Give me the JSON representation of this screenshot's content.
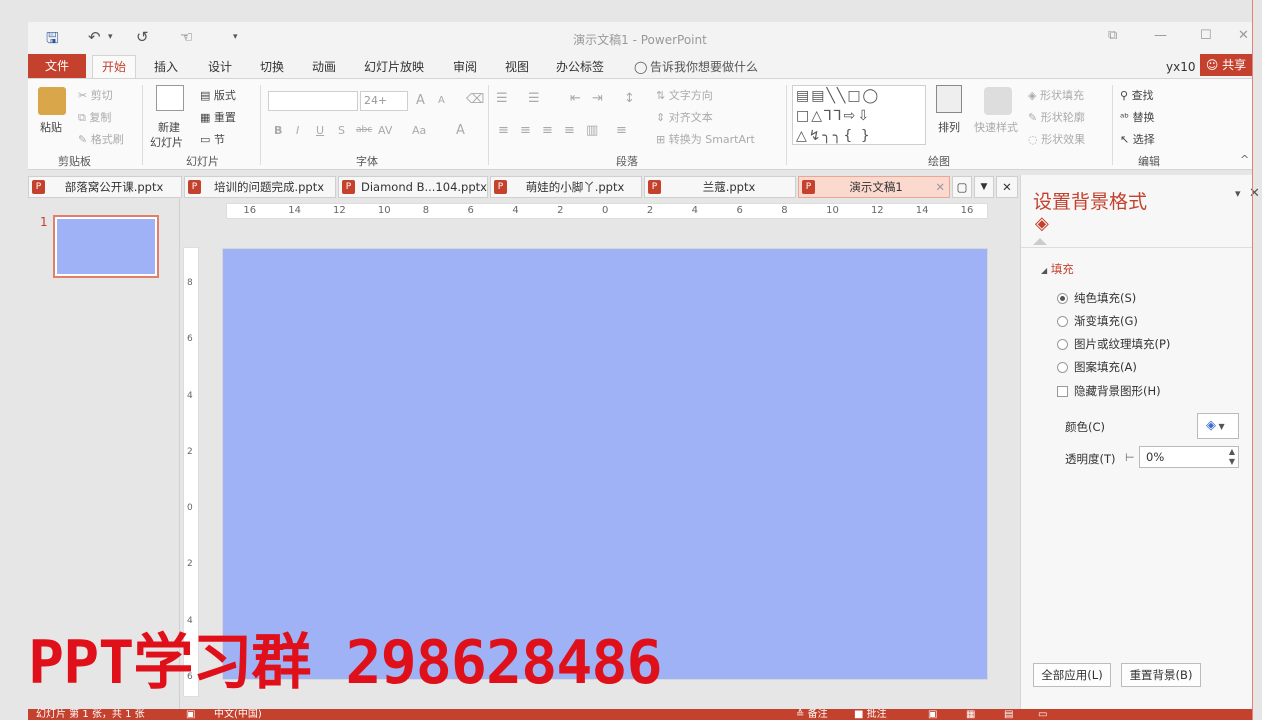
{
  "app": {
    "title": "演示文稿1 - PowerPoint",
    "user": "yx10",
    "share_label": "共享"
  },
  "quick_access": {
    "save_icon": "save-icon",
    "undo_icon": "undo-icon",
    "redo_icon": "redo-icon",
    "touch_icon": "touch-mode-icon",
    "customize_icon": "customize-icon",
    "undo_caret": "▾",
    "customize_caret": "▾"
  },
  "window_controls": {
    "ribbon_display": "⧉",
    "minimize": "—",
    "maximize": "☐",
    "close": "✕"
  },
  "ribbon_tabs": [
    "文件",
    "开始",
    "插入",
    "设计",
    "切换",
    "动画",
    "幻灯片放映",
    "审阅",
    "视图",
    "办公标签"
  ],
  "tell_me": "告诉我你想要做什么",
  "ribbon": {
    "clipboard": {
      "paste": "粘贴",
      "cut": "剪切",
      "copy": "复制",
      "format_painter": "格式刷",
      "label": "剪贴板"
    },
    "slides": {
      "new_slide_1": "新建",
      "new_slide_2": "幻灯片",
      "layout": "版式",
      "reset": "重置",
      "section": "节",
      "label": "幻灯片"
    },
    "font": {
      "size": "24+",
      "grow": "A",
      "shrink": "A",
      "bold": "B",
      "italic": "I",
      "underline": "U",
      "shadow": "S",
      "strike": "abc",
      "spacing": "AV",
      "case": "Aa",
      "color": "A",
      "label": "字体"
    },
    "paragraph": {
      "text_direction": "文字方向",
      "align_text": "对齐文本",
      "smartart": "转换为 SmartArt",
      "label": "段落"
    },
    "drawing": {
      "arrange": "排列",
      "quick_styles": "快速样式",
      "shape_fill": "形状填充",
      "shape_outline": "形状轮廓",
      "shape_effects": "形状效果",
      "label": "绘图"
    },
    "editing": {
      "find": "查找",
      "replace": "替换",
      "select": "选择",
      "label": "编辑"
    }
  },
  "doc_tabs": [
    {
      "name": "部落窝公开课.pptx",
      "active": false
    },
    {
      "name": "培训的问题完成.pptx",
      "active": false
    },
    {
      "name": "Diamond B...104.pptx",
      "active": false
    },
    {
      "name": "萌娃的小脚丫.pptx",
      "active": false
    },
    {
      "name": "兰蔻.pptx",
      "active": false
    },
    {
      "name": "演示文稿1",
      "active": true
    }
  ],
  "slides_panel": {
    "number": "1"
  },
  "slide": {
    "background_color": "#9eb2f5"
  },
  "ruler": {
    "h_labels": [
      "16",
      "14",
      "12",
      "10",
      "8",
      "6",
      "4",
      "2",
      "0",
      "2",
      "4",
      "6",
      "8",
      "10",
      "12",
      "14",
      "16"
    ],
    "v_labels": [
      "8",
      "6",
      "4",
      "2",
      "0",
      "2",
      "4",
      "6"
    ]
  },
  "format_pane": {
    "title": "设置背景格式",
    "section": "填充",
    "options": [
      {
        "label": "纯色填充(S)",
        "checked": true
      },
      {
        "label": "渐变填充(G)",
        "checked": false
      },
      {
        "label": "图片或纹理填充(P)",
        "checked": false
      },
      {
        "label": "图案填充(A)",
        "checked": false
      }
    ],
    "hide_graphics": "隐藏背景图形(H)",
    "color_label": "颜色(C)",
    "transparency_label": "透明度(T)",
    "transparency_value": "0%",
    "apply_all": "全部应用(L)",
    "reset_bg": "重置背景(B)",
    "close_glyph": "✕",
    "menu_glyph": "▾"
  },
  "status": {
    "slide_info": "幻灯片 第 1 张，共 1 张",
    "language": "中文(中国)",
    "notes": "备注",
    "comments": "批注"
  },
  "watermark": "PPT学习群 298628486",
  "colors": {
    "accent": "#c4412e",
    "slide": "#9eb2f5",
    "watermark": "#e0101a"
  }
}
